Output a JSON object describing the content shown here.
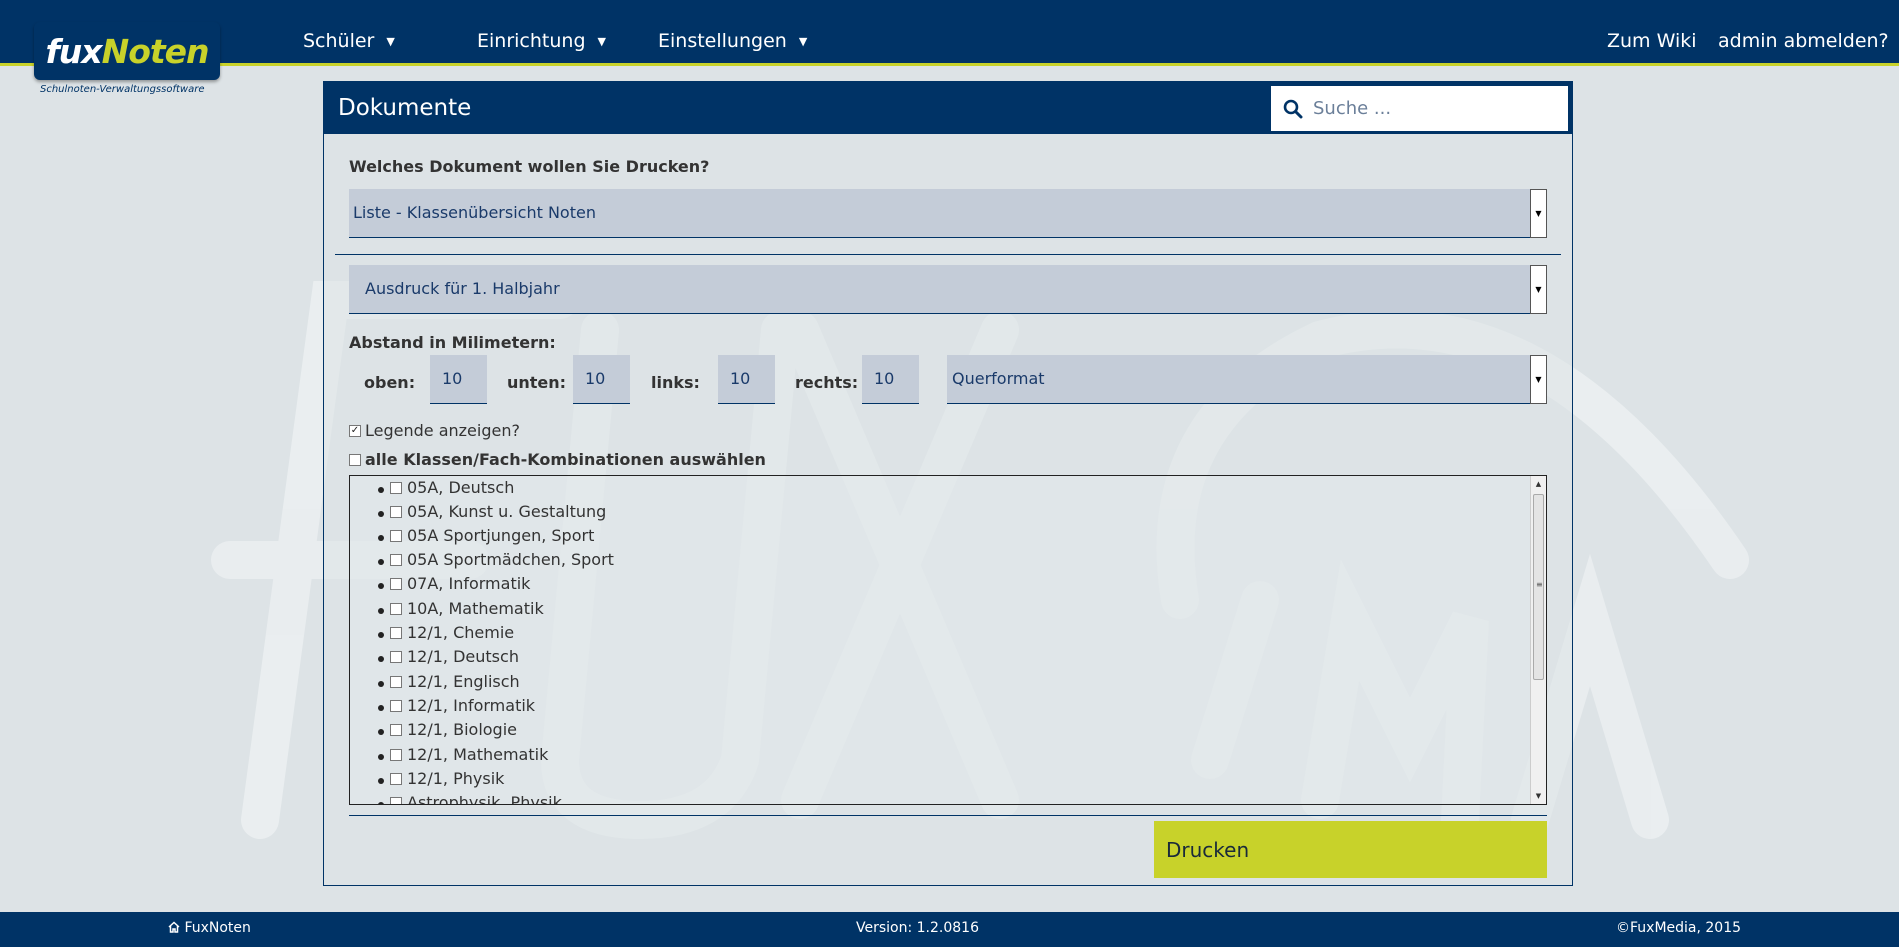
{
  "app": {
    "logo_fux": "fux",
    "logo_noten": "Noten",
    "logo_subtitle": "Schulnoten-Verwaltungssoftware"
  },
  "nav": {
    "items": [
      {
        "label": "Schüler"
      },
      {
        "label": "Einrichtung"
      },
      {
        "label": "Einstellungen"
      }
    ],
    "wiki": "Zum Wiki",
    "logout": "admin abmelden?"
  },
  "panel": {
    "title": "Dokumente",
    "search_placeholder": "Suche ..."
  },
  "form": {
    "question": "Welches Dokument wollen Sie Drucken?",
    "document_select": "Liste - Klassenübersicht Noten",
    "period_select": "Ausdruck für 1. Halbjahr",
    "margins_label": "Abstand in Milimetern:",
    "margin_top_label": "oben:",
    "margin_top_value": "10",
    "margin_bottom_label": "unten:",
    "margin_bottom_value": "10",
    "margin_left_label": "links:",
    "margin_left_value": "10",
    "margin_right_label": "rechts:",
    "margin_right_value": "10",
    "orientation_select": "Querformat",
    "legend_label": "Legende anzeigen?",
    "legend_checked": true,
    "select_all_label": "alle Klassen/Fach-Kombinationen auswählen",
    "select_all_checked": false
  },
  "combinations": [
    "05A, Deutsch",
    "05A, Kunst u. Gestaltung",
    "05A Sportjungen, Sport",
    "05A Sportmädchen, Sport",
    "07A, Informatik",
    "10A, Mathematik",
    "12/1, Chemie",
    "12/1, Deutsch",
    "12/1, Englisch",
    "12/1, Informatik",
    "12/1, Biologie",
    "12/1, Mathematik",
    "12/1, Physik",
    "Astrophysik, Physik"
  ],
  "actions": {
    "print": "Drucken"
  },
  "footer": {
    "home": "FuxNoten",
    "version": "Version: 1.2.0816",
    "copyright": "©FuxMedia, 2015"
  },
  "colors": {
    "navy": "#003366",
    "accent": "#c8d22a"
  }
}
